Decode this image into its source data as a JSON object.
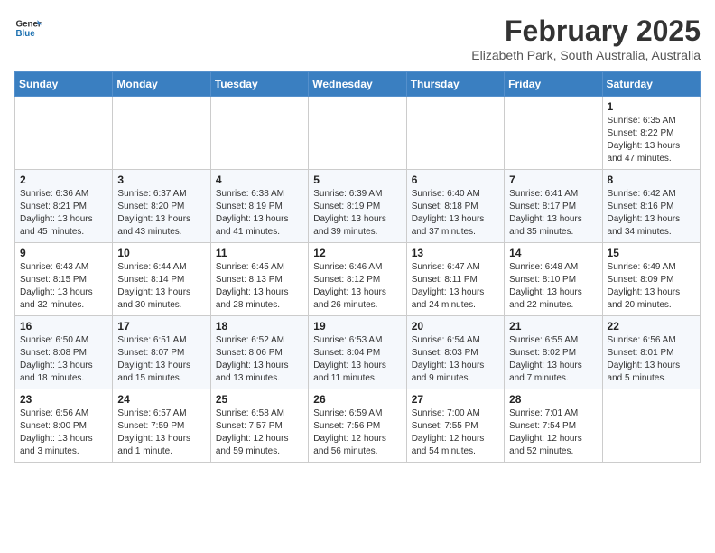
{
  "logo": {
    "line1": "General",
    "line2": "Blue"
  },
  "title": "February 2025",
  "subtitle": "Elizabeth Park, South Australia, Australia",
  "days_of_week": [
    "Sunday",
    "Monday",
    "Tuesday",
    "Wednesday",
    "Thursday",
    "Friday",
    "Saturday"
  ],
  "weeks": [
    [
      {
        "day": "",
        "info": ""
      },
      {
        "day": "",
        "info": ""
      },
      {
        "day": "",
        "info": ""
      },
      {
        "day": "",
        "info": ""
      },
      {
        "day": "",
        "info": ""
      },
      {
        "day": "",
        "info": ""
      },
      {
        "day": "1",
        "info": "Sunrise: 6:35 AM\nSunset: 8:22 PM\nDaylight: 13 hours and 47 minutes."
      }
    ],
    [
      {
        "day": "2",
        "info": "Sunrise: 6:36 AM\nSunset: 8:21 PM\nDaylight: 13 hours and 45 minutes."
      },
      {
        "day": "3",
        "info": "Sunrise: 6:37 AM\nSunset: 8:20 PM\nDaylight: 13 hours and 43 minutes."
      },
      {
        "day": "4",
        "info": "Sunrise: 6:38 AM\nSunset: 8:19 PM\nDaylight: 13 hours and 41 minutes."
      },
      {
        "day": "5",
        "info": "Sunrise: 6:39 AM\nSunset: 8:19 PM\nDaylight: 13 hours and 39 minutes."
      },
      {
        "day": "6",
        "info": "Sunrise: 6:40 AM\nSunset: 8:18 PM\nDaylight: 13 hours and 37 minutes."
      },
      {
        "day": "7",
        "info": "Sunrise: 6:41 AM\nSunset: 8:17 PM\nDaylight: 13 hours and 35 minutes."
      },
      {
        "day": "8",
        "info": "Sunrise: 6:42 AM\nSunset: 8:16 PM\nDaylight: 13 hours and 34 minutes."
      }
    ],
    [
      {
        "day": "9",
        "info": "Sunrise: 6:43 AM\nSunset: 8:15 PM\nDaylight: 13 hours and 32 minutes."
      },
      {
        "day": "10",
        "info": "Sunrise: 6:44 AM\nSunset: 8:14 PM\nDaylight: 13 hours and 30 minutes."
      },
      {
        "day": "11",
        "info": "Sunrise: 6:45 AM\nSunset: 8:13 PM\nDaylight: 13 hours and 28 minutes."
      },
      {
        "day": "12",
        "info": "Sunrise: 6:46 AM\nSunset: 8:12 PM\nDaylight: 13 hours and 26 minutes."
      },
      {
        "day": "13",
        "info": "Sunrise: 6:47 AM\nSunset: 8:11 PM\nDaylight: 13 hours and 24 minutes."
      },
      {
        "day": "14",
        "info": "Sunrise: 6:48 AM\nSunset: 8:10 PM\nDaylight: 13 hours and 22 minutes."
      },
      {
        "day": "15",
        "info": "Sunrise: 6:49 AM\nSunset: 8:09 PM\nDaylight: 13 hours and 20 minutes."
      }
    ],
    [
      {
        "day": "16",
        "info": "Sunrise: 6:50 AM\nSunset: 8:08 PM\nDaylight: 13 hours and 18 minutes."
      },
      {
        "day": "17",
        "info": "Sunrise: 6:51 AM\nSunset: 8:07 PM\nDaylight: 13 hours and 15 minutes."
      },
      {
        "day": "18",
        "info": "Sunrise: 6:52 AM\nSunset: 8:06 PM\nDaylight: 13 hours and 13 minutes."
      },
      {
        "day": "19",
        "info": "Sunrise: 6:53 AM\nSunset: 8:04 PM\nDaylight: 13 hours and 11 minutes."
      },
      {
        "day": "20",
        "info": "Sunrise: 6:54 AM\nSunset: 8:03 PM\nDaylight: 13 hours and 9 minutes."
      },
      {
        "day": "21",
        "info": "Sunrise: 6:55 AM\nSunset: 8:02 PM\nDaylight: 13 hours and 7 minutes."
      },
      {
        "day": "22",
        "info": "Sunrise: 6:56 AM\nSunset: 8:01 PM\nDaylight: 13 hours and 5 minutes."
      }
    ],
    [
      {
        "day": "23",
        "info": "Sunrise: 6:56 AM\nSunset: 8:00 PM\nDaylight: 13 hours and 3 minutes."
      },
      {
        "day": "24",
        "info": "Sunrise: 6:57 AM\nSunset: 7:59 PM\nDaylight: 13 hours and 1 minute."
      },
      {
        "day": "25",
        "info": "Sunrise: 6:58 AM\nSunset: 7:57 PM\nDaylight: 12 hours and 59 minutes."
      },
      {
        "day": "26",
        "info": "Sunrise: 6:59 AM\nSunset: 7:56 PM\nDaylight: 12 hours and 56 minutes."
      },
      {
        "day": "27",
        "info": "Sunrise: 7:00 AM\nSunset: 7:55 PM\nDaylight: 12 hours and 54 minutes."
      },
      {
        "day": "28",
        "info": "Sunrise: 7:01 AM\nSunset: 7:54 PM\nDaylight: 12 hours and 52 minutes."
      },
      {
        "day": "",
        "info": ""
      }
    ]
  ]
}
